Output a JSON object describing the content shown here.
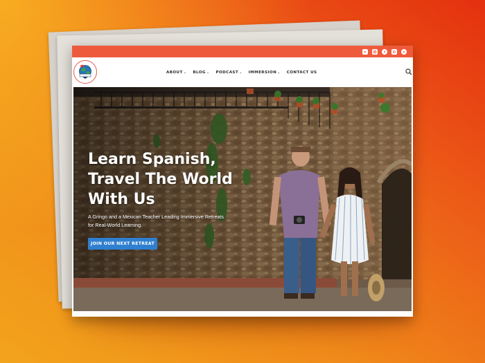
{
  "topbar": {
    "accent": "#ee5b3c",
    "social_icons": [
      "youtube-icon",
      "instagram-icon",
      "facebook-icon",
      "pinterest-icon",
      "spotify-icon"
    ]
  },
  "nav": {
    "items": [
      {
        "label": "ABOUT",
        "has_dropdown": true
      },
      {
        "label": "BLOG",
        "has_dropdown": true
      },
      {
        "label": "PODCAST",
        "has_dropdown": true
      },
      {
        "label": "IMMERSION",
        "has_dropdown": true
      },
      {
        "label": "CONTACT US",
        "has_dropdown": false
      }
    ],
    "search_icon": "search-icon"
  },
  "hero": {
    "title_line1": "Learn Spanish,",
    "title_line2": "Travel The World",
    "title_line3": "With Us",
    "subtitle_line1": "A Gringo and a Mexican Teacher Leading Immersive Retreats",
    "subtitle_line2": "for Real-World Learning.",
    "cta_label": "JOIN OUR NEXT RETREAT",
    "cta_color": "#2f7fd0"
  },
  "page_background": {
    "gradient_start": "#f2a41c",
    "gradient_end": "#e4300f"
  }
}
